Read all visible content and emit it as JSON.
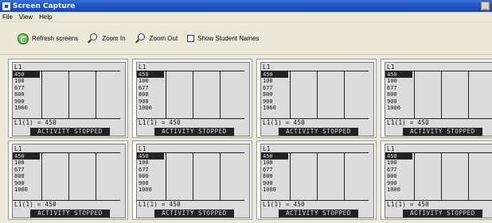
{
  "window": {
    "title": "Screen Capture"
  },
  "menu": [
    "File",
    "View",
    "Help"
  ],
  "toolbar": {
    "refresh_label": "Refresh screens",
    "zoom_in_label": "Zoom In",
    "zoom_out_label": "Zoom Out",
    "show_names_label": "Show Student Names",
    "show_names_checked": false
  },
  "screens": [
    {
      "list_name": "L1",
      "values": [
        "450",
        "100",
        "677",
        "800",
        "900",
        "1000"
      ],
      "cell": "L1(1) = 450",
      "status": "ACTIVITY STOPPED"
    },
    {
      "list_name": "L1",
      "values": [
        "450",
        "100",
        "677",
        "800",
        "900",
        "1000"
      ],
      "cell": "L1(1) = 450",
      "status": "ACTIVITY STOPPED"
    },
    {
      "list_name": "L1",
      "values": [
        "450",
        "100",
        "677",
        "800",
        "900",
        "1000"
      ],
      "cell": "L1(1) = 450",
      "status": "ACTIVITY STOPPED"
    },
    {
      "list_name": "L1",
      "values": [
        "450",
        "100",
        "677",
        "800",
        "900",
        "1000"
      ],
      "cell": "L1(1) = 450",
      "status": "ACTIVITY STOPPED"
    },
    {
      "list_name": "L1",
      "values": [
        "450",
        "100",
        "677",
        "800",
        "900",
        "1000"
      ],
      "cell": "L1(1) = 450",
      "status": "ACTIVITY STOPPED"
    },
    {
      "list_name": "L1",
      "values": [
        "450",
        "100",
        "677",
        "800",
        "900",
        "1000"
      ],
      "cell": "L1(1) = 450",
      "status": "ACTIVITY STOPPED"
    },
    {
      "list_name": "L1",
      "values": [
        "450",
        "100",
        "677",
        "800",
        "900",
        "1000"
      ],
      "cell": "L1(1) = 450",
      "status": "ACTIVITY STOPPED"
    },
    {
      "list_name": "L1",
      "values": [
        "450",
        "100",
        "677",
        "800",
        "900",
        "1000"
      ],
      "cell": "L1(1) = 450",
      "status": "ACTIVITY STOPPED"
    }
  ]
}
